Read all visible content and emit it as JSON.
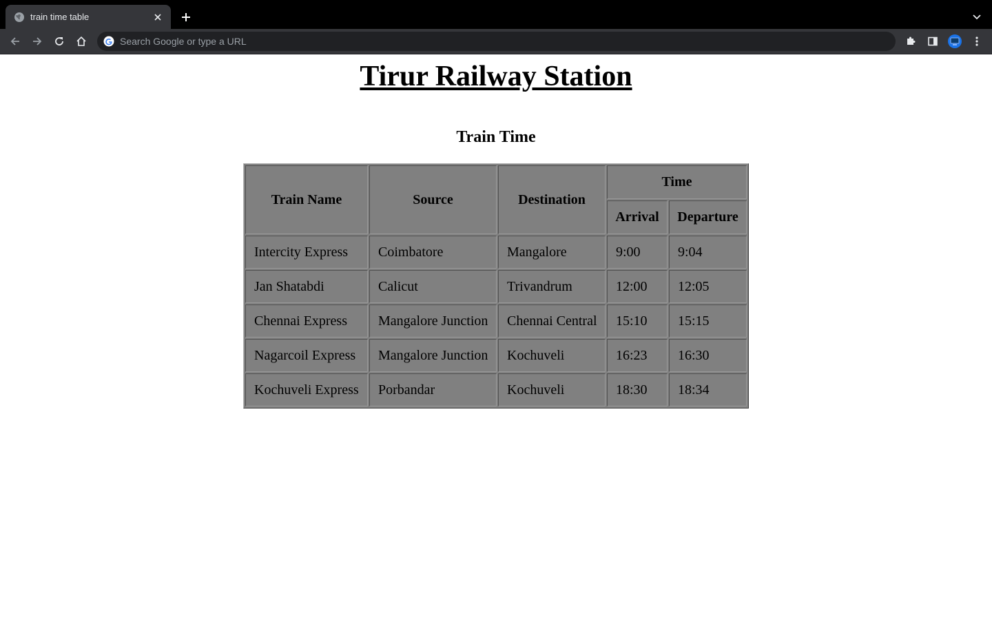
{
  "browser": {
    "tab_title": "train time table",
    "omnibox_placeholder": "Search Google or type a URL"
  },
  "page": {
    "title": "Tirur Railway Station",
    "section_title": "Train Time"
  },
  "table": {
    "headers": {
      "train_name": "Train Name",
      "source": "Source",
      "destination": "Destination",
      "time": "Time",
      "arrival": "Arrival",
      "departure": "Departure"
    },
    "rows": [
      {
        "train": "Intercity Express",
        "source": "Coimbatore",
        "destination": "Mangalore",
        "arrival": "9:00",
        "departure": "9:04"
      },
      {
        "train": "Jan Shatabdi",
        "source": "Calicut",
        "destination": "Trivandrum",
        "arrival": "12:00",
        "departure": "12:05"
      },
      {
        "train": "Chennai Express",
        "source": "Mangalore Junction",
        "destination": "Chennai Central",
        "arrival": "15:10",
        "departure": "15:15"
      },
      {
        "train": "Nagarcoil Express",
        "source": "Mangalore Junction",
        "destination": "Kochuveli",
        "arrival": "16:23",
        "departure": "16:30"
      },
      {
        "train": "Kochuveli Express",
        "source": "Porbandar",
        "destination": "Kochuveli",
        "arrival": "18:30",
        "departure": "18:34"
      }
    ]
  },
  "colors": {
    "table_background": "#808080",
    "chrome_dark": "#35363a"
  }
}
